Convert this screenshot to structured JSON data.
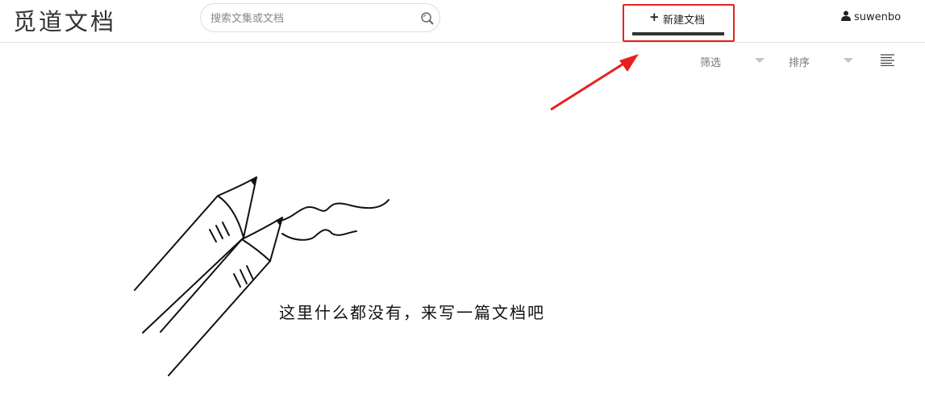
{
  "header": {
    "logo": "觅道文档",
    "search_placeholder": "搜索文集或文档",
    "new_doc_plus": "+",
    "new_doc_label": "新建文档",
    "username": "suwenbo"
  },
  "toolbar": {
    "filter_label": "筛选",
    "sort_label": "排序"
  },
  "empty_state": {
    "message": "这里什么都没有，来写一篇文档吧"
  },
  "annotation": {
    "color": "#e8211d"
  }
}
